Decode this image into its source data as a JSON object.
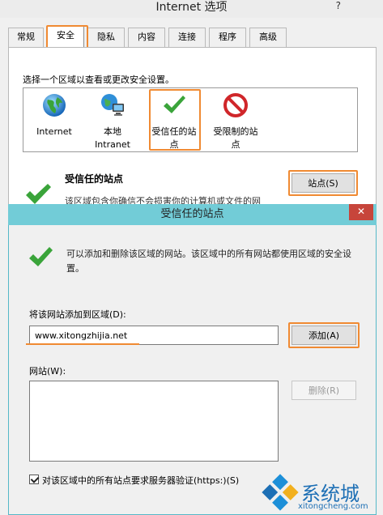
{
  "outer_dialog": {
    "title": "Internet 选项",
    "help": "?",
    "tabs": [
      "常规",
      "安全",
      "隐私",
      "内容",
      "连接",
      "程序",
      "高级"
    ],
    "active_tab": "安全",
    "zone_instruction": "选择一个区域以查看或更改安全设置。",
    "zones": [
      {
        "line1": "Internet",
        "line2": "",
        "icon": "globe-icon"
      },
      {
        "line1": "本地",
        "line2": "Intranet",
        "icon": "intranet-computer-icon"
      },
      {
        "line1": "受信任的站",
        "line2": "点",
        "icon": "green-check-icon"
      },
      {
        "line1": "受限制的站",
        "line2": "点",
        "icon": "no-entry-icon"
      }
    ],
    "selected_zone_title": "受信任的站点",
    "selected_zone_description": "该区域包含你确信不会损害你的计算机或文件的网",
    "sites_button": "站点(S)"
  },
  "inner_dialog": {
    "title": "受信任的站点",
    "close": "✕",
    "description": "可以添加和删除该区域的网站。该区域中的所有网站都使用区域的安全设置。",
    "add_label": "将该网站添加到区域(D):",
    "url_value": "www.xitongzhijia.net",
    "add_button": "添加(A)",
    "websites_label": "网站(W):",
    "remove_button": "删除(R)",
    "https_label": "对该区域中的所有站点要求服务器验证(https:)(S)",
    "https_checked": true
  },
  "watermark": {
    "brand": "系统城",
    "url": "xitongcheng.com"
  },
  "colors": {
    "highlight": "#f08a32",
    "inner_titlebar": "#72ccd7",
    "close_red": "#c7453b",
    "check_green": "#3aa43a"
  }
}
